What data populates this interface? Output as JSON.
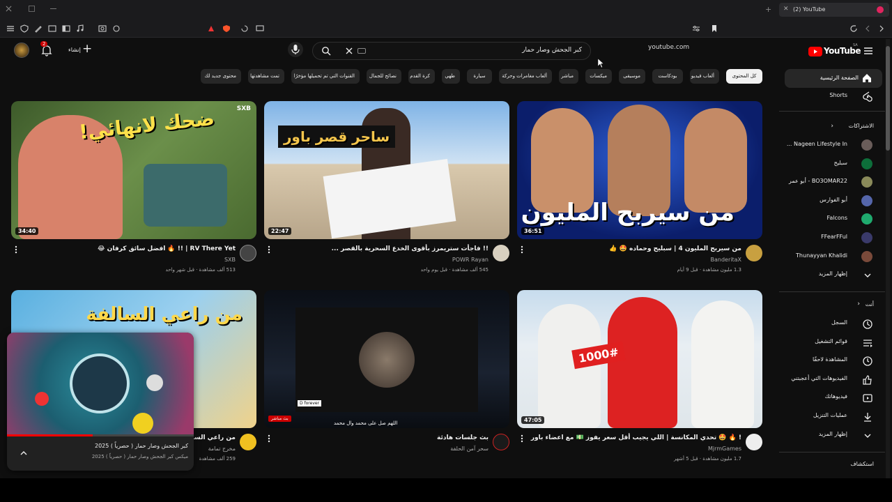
{
  "browser": {
    "tab_title": "(2) YouTube",
    "url": "youtube.com"
  },
  "masthead": {
    "create_label": "إنشاء",
    "notification_count": "2",
    "search_query": "كبر الجحش وصار حمار",
    "logo_text": "YouTube",
    "region": "SA"
  },
  "chips": [
    "كل المحتوى",
    "ألعاب فيديو",
    "بودكاست",
    "موسيقى",
    "ميكسات",
    "مباشر",
    "ألعاب مغامرات وحركة",
    "سيارة",
    "طهي",
    "كرة القدم",
    "نصائح للجمال",
    "القنوات التي تم تحميلها مؤخرًا",
    "تمت مشاهدتها",
    "محتوى جديد لك"
  ],
  "videos": [
    {
      "title": "من سيربح المليون 4 | سبليح وحماده 🤩 👍",
      "channel": "BanderitaX",
      "meta": "1.3 مليون مشاهدة · قبل 9 أيام",
      "duration": "36:51",
      "overlay": "من سيربح المليون",
      "verified": true
    },
    {
      "title": "!! فاجأت ستريمرز بأقوى الخدع السحرية بالقصر ...",
      "channel": "POWR Rayan",
      "meta": "545 ألف مشاهدة · قبل يوم واحد",
      "duration": "22:47",
      "overlay": "ساحر قصر باور"
    },
    {
      "title": "RV There Yet | !! 🔥 افضل سائق كرفان 😂",
      "channel": "SXB",
      "meta": "513 ألف مشاهدة · قبل شهر واحد",
      "duration": "34:40",
      "overlay": "ضحك لانهائي!",
      "brand": "SXB"
    },
    {
      "title": "! 🔥 🤩 تحدي المكانسة | اللي يجيب أقل سعر يفوز 💵 مع اعضاء باور",
      "channel": "MjrmGames",
      "meta": "1.7 مليون مشاهدة · قبل 5 أشهر",
      "duration": "47:05",
      "overlay": "1000#",
      "verified": true
    },
    {
      "title": "بث جلسات هادئة",
      "channel": "سحر آمن الحلفة",
      "meta": "",
      "live_label": "بث مباشر",
      "caption": "اللهم صل على محمد وال محمد",
      "forever": "D forever"
    },
    {
      "title": "من راعي السالفة ...",
      "channel": "مخرج تمامة",
      "meta": "259 ألف مشاهدة",
      "overlay": "من راعي السالفة"
    }
  ],
  "miniplayer": {
    "title": "كبر الجحش وصار حمار ( حصرياً ) 2025",
    "subtitle": "ميكس كبر الجحش وصار حمار ( حصرياً ) 2025"
  },
  "sidebar": {
    "home": "الصفحة الرئيسية",
    "shorts": "Shorts",
    "subs_header": "الاشتراكات",
    "subscriptions": [
      {
        "name": "Nageen Lifestyle In ...",
        "color": "#6a5d5a"
      },
      {
        "name": "سبليح",
        "color": "#0d6e3a"
      },
      {
        "name": "BO3OMAR22 - أبو عمر",
        "color": "#8a8a5a"
      },
      {
        "name": "أبو الفوارس",
        "color": "#5566aa"
      },
      {
        "name": "Falcons",
        "color": "#1faa6e"
      },
      {
        "name": "FFearFFul",
        "color": "#3a3a6a"
      },
      {
        "name": "Thunayyan Khalidi",
        "color": "#7a4a3a"
      }
    ],
    "show_more_1": "إظهار المزيد",
    "you_header": "أنت",
    "you_items": [
      "السجل",
      "قوائم التشغيل",
      "المشاهدة لاحقًا",
      "الفيديوهات التي أعجبتني",
      "فيديوهاتك",
      "عمليات التنزيل"
    ],
    "show_more_2": "إظهار المزيد",
    "explore_header": "استكشاف"
  },
  "colors": {
    "bg": "#0f0f0f",
    "yt_red": "#ff0000",
    "chip_bg": "#272727"
  }
}
